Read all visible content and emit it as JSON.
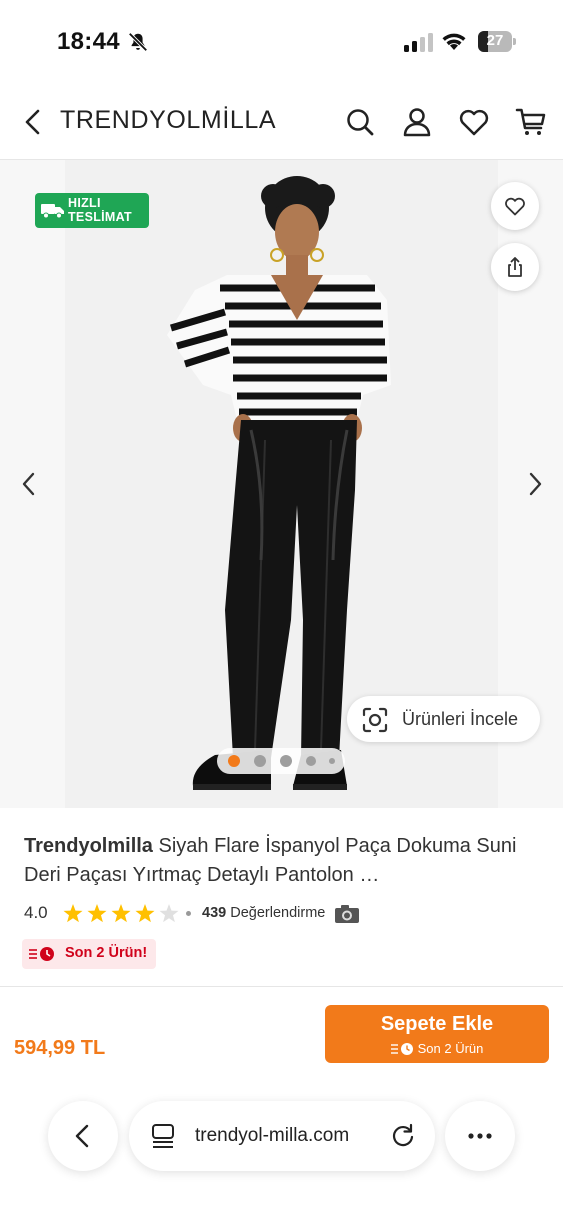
{
  "status_bar": {
    "time": "18:44",
    "battery_level": "27",
    "icons": [
      "bell-slash-icon",
      "signal-icon",
      "wifi-icon",
      "battery-icon"
    ]
  },
  "header": {
    "brand": "TRENDYOLMİLLA",
    "icons": [
      "back-icon",
      "search-icon",
      "user-icon",
      "heart-icon",
      "cart-icon"
    ]
  },
  "gallery": {
    "badge_line1": "HIZLI",
    "badge_line2": "TESLİMAT",
    "inspect_label": "Ürünleri İncele",
    "image_count": 5,
    "active_index": 0,
    "colors": {
      "badge": "#1fa655",
      "active_dot": "#f27a1a"
    }
  },
  "product": {
    "brand": "Trendyolmilla",
    "name": " Siyah Flare İspanyol Paça Dokuma Suni Deri Paçası Yırtmaç Detaylı Pantolon …",
    "rating": "4.0",
    "rating_stars": 4,
    "review_count": "439",
    "review_label": " Değerlendirme",
    "stock_badge": "Son 2 Ürün!"
  },
  "buy_bar": {
    "price": "594,99 TL",
    "cart_button": "Sepete Ekle",
    "cart_sub": "Son 2 Ürün",
    "accent_color": "#f27a1a"
  },
  "browser": {
    "url": "trendyol-milla.com"
  }
}
